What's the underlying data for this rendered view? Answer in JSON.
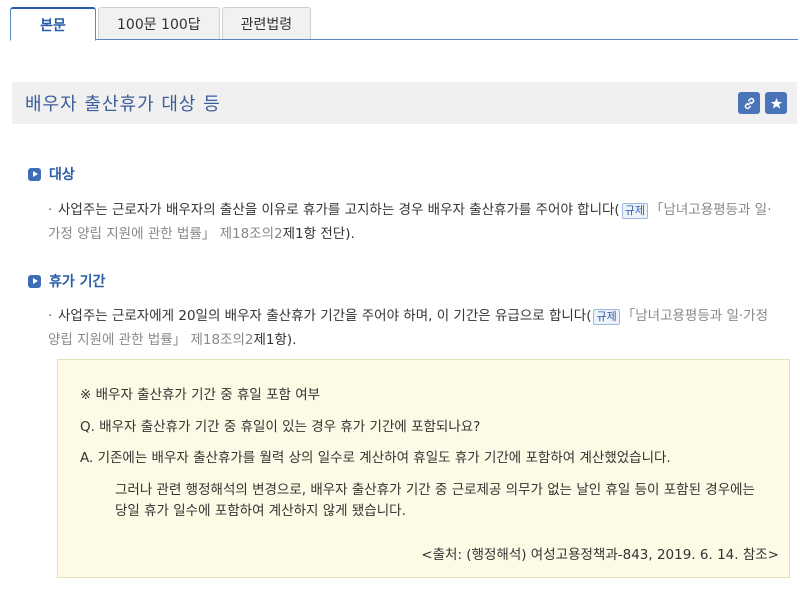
{
  "tabs": [
    {
      "label": "본문",
      "active": true
    },
    {
      "label": "100문 100답",
      "active": false
    },
    {
      "label": "관련법령",
      "active": false
    }
  ],
  "title": "배우자 출산휴가 대상 등",
  "title_buttons": [
    {
      "icon": "link-icon"
    },
    {
      "icon": "star-icon"
    }
  ],
  "sections": [
    {
      "heading": "대상",
      "text_before": "사업주는 근로자가 배우자의 출산을 이유로 휴가를 고지하는 경우 배우자 출산휴가를 주어야 합니다(",
      "tag": "규제",
      "law": "「남녀고용평등과 일·가정 양립 지원에 관한 법률」",
      "article": " 제18조의2",
      "article_bold": "제1항 전단",
      "text_after": ")."
    },
    {
      "heading": "휴가 기간",
      "text_before": "사업주는 근로자에게 20일의 배우자 출산휴가 기간을 주어야 하며, 이 기간은 유급으로 합니다(",
      "tag": "규제",
      "law": "「남녀고용평등과 일·가정 양립 지원에 관한 법률」",
      "article": " 제18조의2",
      "article_bold": "제1항",
      "text_after": ")."
    }
  ],
  "box": {
    "note": "※ 배우자 출산휴가 기간 중 휴일 포함 여부",
    "question": "Q. 배우자 출산휴가 기간 중 휴일이 있는 경우 휴가 기간에 포함되나요?",
    "answer": "A. 기존에는 배우자 출산휴가를 월력 상의 일수로 계산하여 휴일도 휴가 기간에 포함하여 계산했었습니다.",
    "answer2_line1": "그러나 관련 행정해석의 변경으로, 배우자 출산휴가 기간 중 근로제공 의무가 없는 날인 휴일 등이 포함된 경우에는",
    "answer2_line2": "당일 휴가 일수에 포함하여 계산하지 않게 됐습니다.",
    "source": "<출처: (행정해석) 여성고용정책과-843, 2019. 6. 14. 참조>"
  },
  "colors": {
    "accent": "#2a5da9",
    "box_bg": "#fdfbe5",
    "title_bg": "#f0f0f0"
  }
}
